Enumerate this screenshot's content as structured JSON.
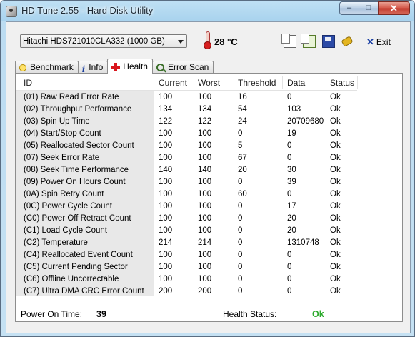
{
  "window": {
    "title": "HD Tune 2.55 - Hard Disk Utility",
    "min_label": "–",
    "max_label": "□",
    "close_label": "✕"
  },
  "toolbar": {
    "drive": "Hitachi HDS721010CLA332 (1000 GB)",
    "temperature": "28 °C",
    "exit_label": "Exit",
    "exit_icon": "✕",
    "icons": [
      "copy-text-icon",
      "copy-screenshot-icon",
      "save-icon",
      "options-icon"
    ]
  },
  "tabs": [
    {
      "label": "Benchmark",
      "icon": "benchmark-icon"
    },
    {
      "label": "Info",
      "icon": "info-icon",
      "glyph": "i"
    },
    {
      "label": "Health",
      "icon": "health-icon",
      "active": true
    },
    {
      "label": "Error Scan",
      "icon": "error-scan-icon"
    }
  ],
  "table": {
    "columns": [
      "ID",
      "Current",
      "Worst",
      "Threshold",
      "Data",
      "Status"
    ],
    "rows": [
      [
        "(01) Raw Read Error Rate",
        "100",
        "100",
        "16",
        "0",
        "Ok"
      ],
      [
        "(02) Throughput Performance",
        "134",
        "134",
        "54",
        "103",
        "Ok"
      ],
      [
        "(03) Spin Up Time",
        "122",
        "122",
        "24",
        "20709680",
        "Ok"
      ],
      [
        "(04) Start/Stop Count",
        "100",
        "100",
        "0",
        "19",
        "Ok"
      ],
      [
        "(05) Reallocated Sector Count",
        "100",
        "100",
        "5",
        "0",
        "Ok"
      ],
      [
        "(07) Seek Error Rate",
        "100",
        "100",
        "67",
        "0",
        "Ok"
      ],
      [
        "(08) Seek Time Performance",
        "140",
        "140",
        "20",
        "30",
        "Ok"
      ],
      [
        "(09) Power On Hours Count",
        "100",
        "100",
        "0",
        "39",
        "Ok"
      ],
      [
        "(0A) Spin Retry Count",
        "100",
        "100",
        "60",
        "0",
        "Ok"
      ],
      [
        "(0C) Power Cycle Count",
        "100",
        "100",
        "0",
        "17",
        "Ok"
      ],
      [
        "(C0) Power Off Retract Count",
        "100",
        "100",
        "0",
        "20",
        "Ok"
      ],
      [
        "(C1) Load Cycle Count",
        "100",
        "100",
        "0",
        "20",
        "Ok"
      ],
      [
        "(C2) Temperature",
        "214",
        "214",
        "0",
        "1310748",
        "Ok"
      ],
      [
        "(C4) Reallocated Event Count",
        "100",
        "100",
        "0",
        "0",
        "Ok"
      ],
      [
        "(C5) Current Pending Sector",
        "100",
        "100",
        "0",
        "0",
        "Ok"
      ],
      [
        "(C6) Offline Uncorrectable",
        "100",
        "100",
        "0",
        "0",
        "Ok"
      ],
      [
        "(C7) Ultra DMA CRC Error Count",
        "200",
        "200",
        "0",
        "0",
        "Ok"
      ]
    ]
  },
  "status": {
    "power_on_label": "Power On Time:",
    "power_on_value": "39",
    "health_label": "Health Status:",
    "health_value": "Ok",
    "health_color": "#2daa2d"
  }
}
